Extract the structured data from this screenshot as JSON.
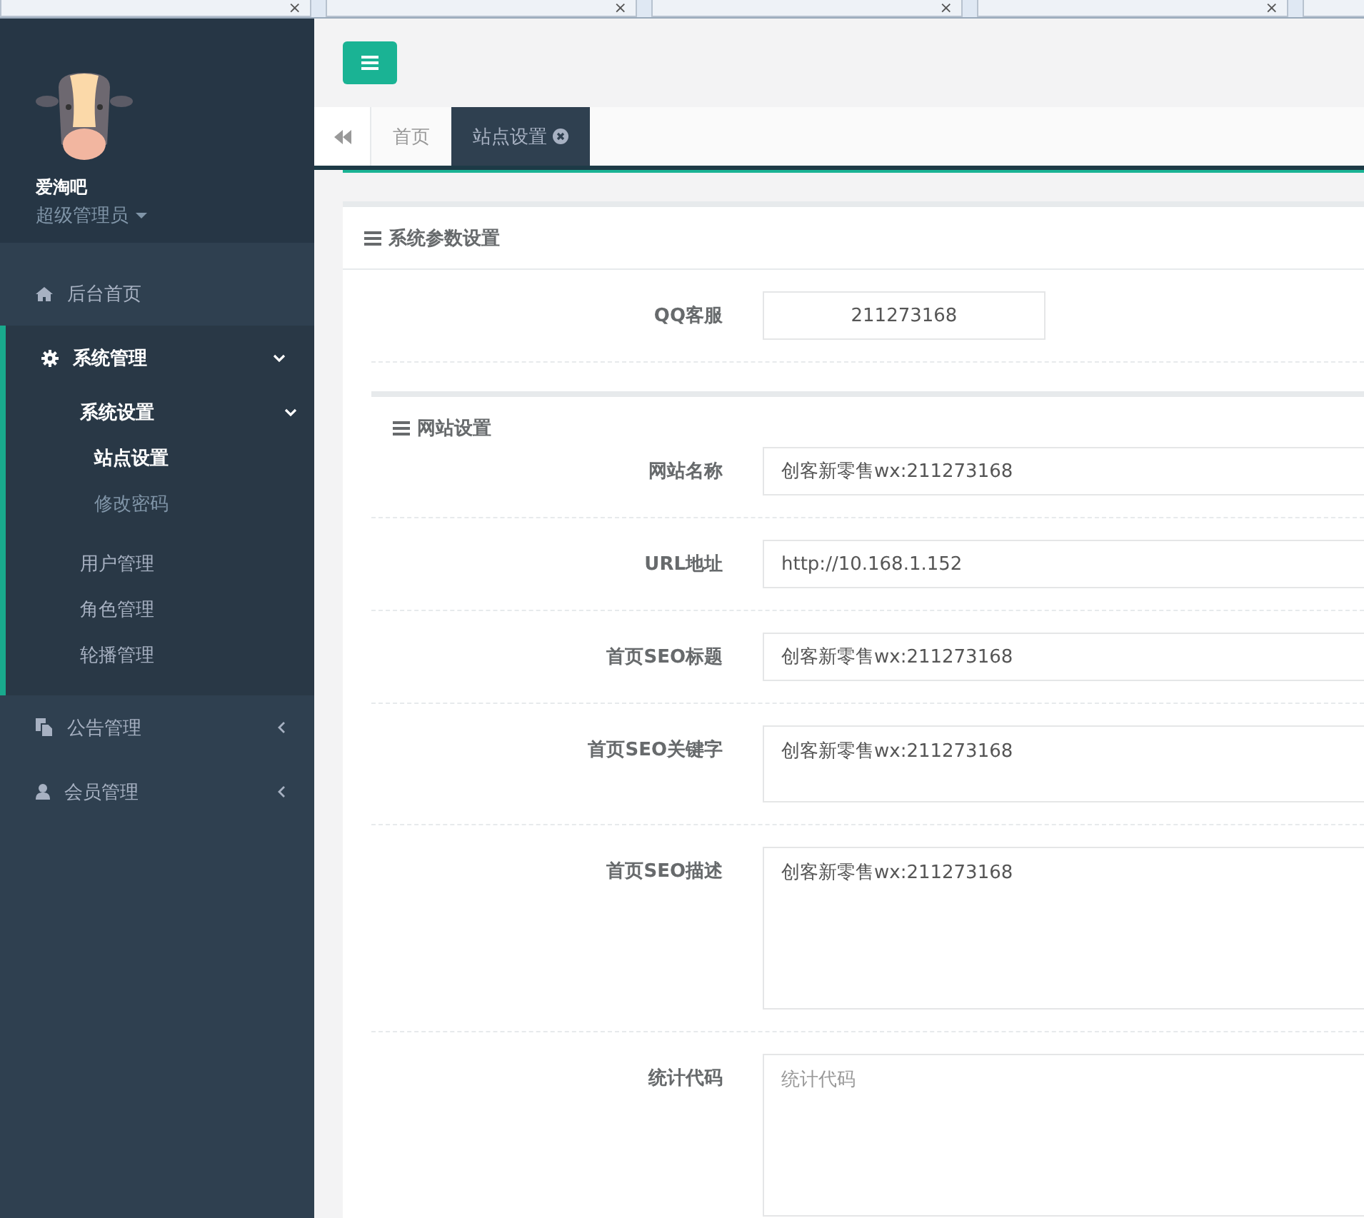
{
  "browser_tabs": [
    {
      "close": "×"
    },
    {
      "close": "×"
    },
    {
      "close": "×"
    },
    {
      "close": "×"
    }
  ],
  "profile": {
    "name": "爱淘吧",
    "role": "超级管理员"
  },
  "sidebar": {
    "items": [
      {
        "label": "后台首页",
        "kind": "link",
        "expanded": false
      },
      {
        "label": "系统管理",
        "kind": "menu",
        "expanded": true,
        "children": [
          {
            "label": "系统设置",
            "expanded": true,
            "children": [
              {
                "label": "站点设置",
                "selected": true
              },
              {
                "label": "修改密码",
                "selected": false
              }
            ]
          },
          {
            "label": "用户管理"
          },
          {
            "label": "角色管理"
          },
          {
            "label": "轮播管理"
          }
        ]
      },
      {
        "label": "公告管理",
        "kind": "menu",
        "expanded": false
      },
      {
        "label": "会员管理",
        "kind": "menu",
        "expanded": false
      }
    ]
  },
  "page_tabs": [
    {
      "label": "首页",
      "kind": "fixed",
      "selected": false
    },
    {
      "label": "站点设置",
      "kind": "closable",
      "selected": true
    }
  ],
  "panel_title": "系统参数设置",
  "qq_row": {
    "label": "QQ客服",
    "value": "211273168"
  },
  "section_title": "网站设置",
  "fields": [
    {
      "label": "网站名称",
      "kind": "input",
      "value": "创客新零售wx:211273168"
    },
    {
      "label": "URL地址",
      "kind": "input",
      "value": "http://10.168.1.152"
    },
    {
      "label": "首页SEO标题",
      "kind": "input",
      "value": "创客新零售wx:211273168"
    },
    {
      "label": "首页SEO关键字",
      "kind": "textarea",
      "value": "创客新零售wx:211273168"
    },
    {
      "label": "首页SEO描述",
      "kind": "tall-textarea",
      "value": "创客新零售wx:211273168"
    },
    {
      "label": "统计代码",
      "kind": "tall-textarea",
      "placeholder": "统计代码"
    }
  ]
}
